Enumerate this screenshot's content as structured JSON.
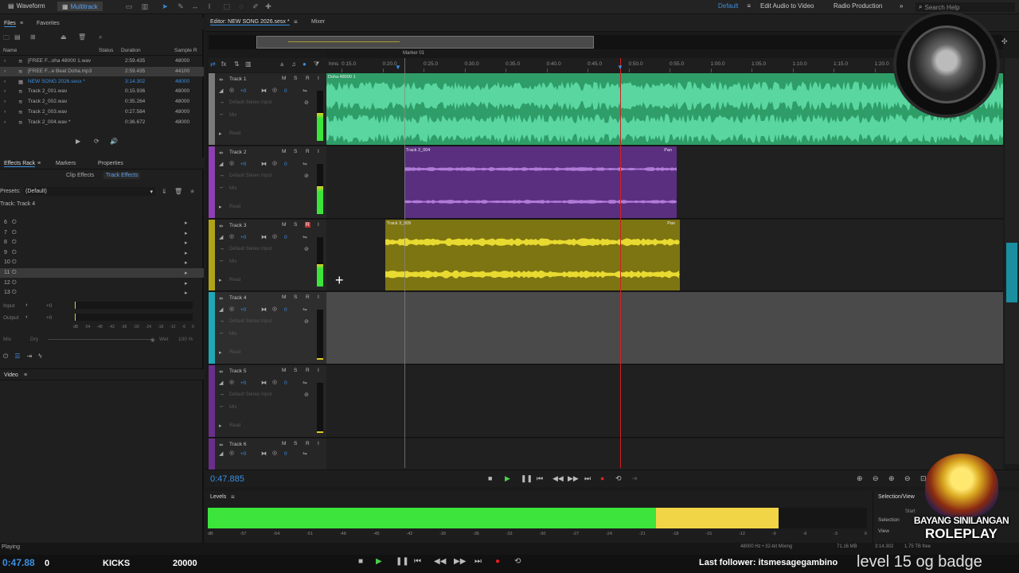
{
  "topbar": {
    "waveform": "Waveform",
    "multitrack": "Multitrack",
    "workspace": "Default",
    "edit_video": "Edit Audio to Video",
    "radio": "Radio Production",
    "search": "Search Help"
  },
  "files": {
    "tab_files": "Files",
    "tab_favorites": "Favorites",
    "col_name": "Name",
    "col_status": "Status",
    "col_duration": "Duration",
    "col_rate": "Sample R",
    "rows": [
      {
        "name": "[FREE F...oha 48000 1.wav",
        "duration": "2:59.435",
        "rate": "48000",
        "color": "#a8a8a8"
      },
      {
        "name": "[FREE F...e Beat Doha.mp3",
        "duration": "2:59.435",
        "rate": "44100",
        "color": "#a8a8a8"
      },
      {
        "name": "NEW SONG 2026.sesx *",
        "duration": "3:14.302",
        "rate": "48000",
        "color": "#3a8fe0"
      },
      {
        "name": "Track 2_001.wav",
        "duration": "0:15.936",
        "rate": "48000",
        "color": "#a8a8a8"
      },
      {
        "name": "Track 2_002.wav",
        "duration": "0:35.264",
        "rate": "48000",
        "color": "#a8a8a8"
      },
      {
        "name": "Track 2_003.wav",
        "duration": "0:27.584",
        "rate": "48000",
        "color": "#a8a8a8"
      },
      {
        "name": "Track 2_004.wav *",
        "duration": "0:36.672",
        "rate": "48000",
        "color": "#a8a8a8"
      }
    ]
  },
  "effects": {
    "tab_rack": "Effects Rack",
    "tab_markers": "Markers",
    "tab_properties": "Properties",
    "clip_effects": "Clip Effects",
    "track_effects": "Track Effects",
    "presets_label": "Presets:",
    "presets_value": "(Default)",
    "track_label": "Track: Track 4",
    "slots": [
      "6",
      "7",
      "8",
      "9",
      "10",
      "11",
      "12",
      "13"
    ],
    "input": "Input",
    "output": "Output",
    "input_val": "+0",
    "output_val": "+0",
    "mix": "Mix",
    "dry": "Dry",
    "wet": "Wet",
    "wet_val": "100 %",
    "scale": [
      "dB",
      "-54",
      "-48",
      "-42",
      "-36",
      "-30",
      "-24",
      "-18",
      "-12",
      "-6",
      "0"
    ]
  },
  "video_label": "Video",
  "editor": {
    "title": "Editor: NEW SONG 2026.sesx *",
    "mixer": "Mixer",
    "marker": "Marker 01",
    "hms": "hms",
    "ticks": [
      "0:15.0",
      "0:20.0",
      "0:25.0",
      "0:30.0",
      "0:35.0",
      "0:40.0",
      "0:45.0",
      "0:50.0",
      "0:55.0",
      "1:00.0",
      "1:05.0",
      "1:10.0",
      "1:15.0",
      "1:20.0"
    ]
  },
  "tracks": [
    {
      "name": "Track 1",
      "color": "#7a7a7a",
      "vol": "+0",
      "pan": "0",
      "input": "Default Stereo Input",
      "clip": "Doha 48000 1",
      "clip_color": "#2f9d67",
      "wave_color": "#5ad6a0"
    },
    {
      "name": "Track 2",
      "color": "#8e3fb2",
      "vol": "+0",
      "pan": "0",
      "input": "Default Stereo Input",
      "clip": "Track 2_004",
      "clip_color": "#5a2f80",
      "wave_color": "#b07ad8"
    },
    {
      "name": "Track 3",
      "color": "#b0a318",
      "vol": "+0",
      "pan": "0",
      "input": "Default Stereo Input",
      "clip": "Track 3_005",
      "clip_color": "#7d7412",
      "wave_color": "#e8da30"
    },
    {
      "name": "Track 4",
      "color": "#1ea8b8",
      "vol": "+0",
      "pan": "0",
      "input": "Default Stereo Input",
      "clip": "",
      "clip_color": "",
      "wave_color": ""
    },
    {
      "name": "Track 5",
      "color": "#6a2f8a",
      "vol": "+0",
      "pan": "0",
      "input": "Default Stereo Input",
      "clip": "",
      "clip_color": "",
      "wave_color": ""
    },
    {
      "name": "Track 6",
      "color": "#6a2f8a",
      "vol": "+0",
      "pan": "0",
      "input": "",
      "clip": "",
      "clip_color": "",
      "wave_color": ""
    }
  ],
  "labels": {
    "m": "M",
    "s": "S",
    "r": "R",
    "i": "I",
    "mix": "Mix",
    "read": "Read",
    "pan": "Pan"
  },
  "transport": {
    "time": "0:47.885"
  },
  "levels": {
    "title": "Levels",
    "scale": [
      "dB",
      "-57",
      "-54",
      "-51",
      "-48",
      "-45",
      "-42",
      "-39",
      "-36",
      "-33",
      "-30",
      "-27",
      "-24",
      "-21",
      "-18",
      "-15",
      "-12",
      "-9",
      "-6",
      "-3",
      "0"
    ],
    "green_pct": 0.68,
    "yellow_pct": 0.186
  },
  "selection": {
    "title": "Selection/View",
    "start": "Start",
    "selection": "Selection",
    "view": "View"
  },
  "status": {
    "playing": "Playing",
    "format": "48000 Hz • 32-bit Mixing",
    "size": "71.16 MB",
    "dur": "3:14.302",
    "free": "1.75 TB free"
  },
  "stream": {
    "time": "0:47.88",
    "zero": "0",
    "kicks": "KICKS",
    "count": "20000",
    "follower": "Last follower: itsmesagegambino",
    "level": "level 15 og badge"
  },
  "logo_text": {
    "line1": "BAYANG SINILANGAN",
    "line2": "ROLEPLAY"
  }
}
